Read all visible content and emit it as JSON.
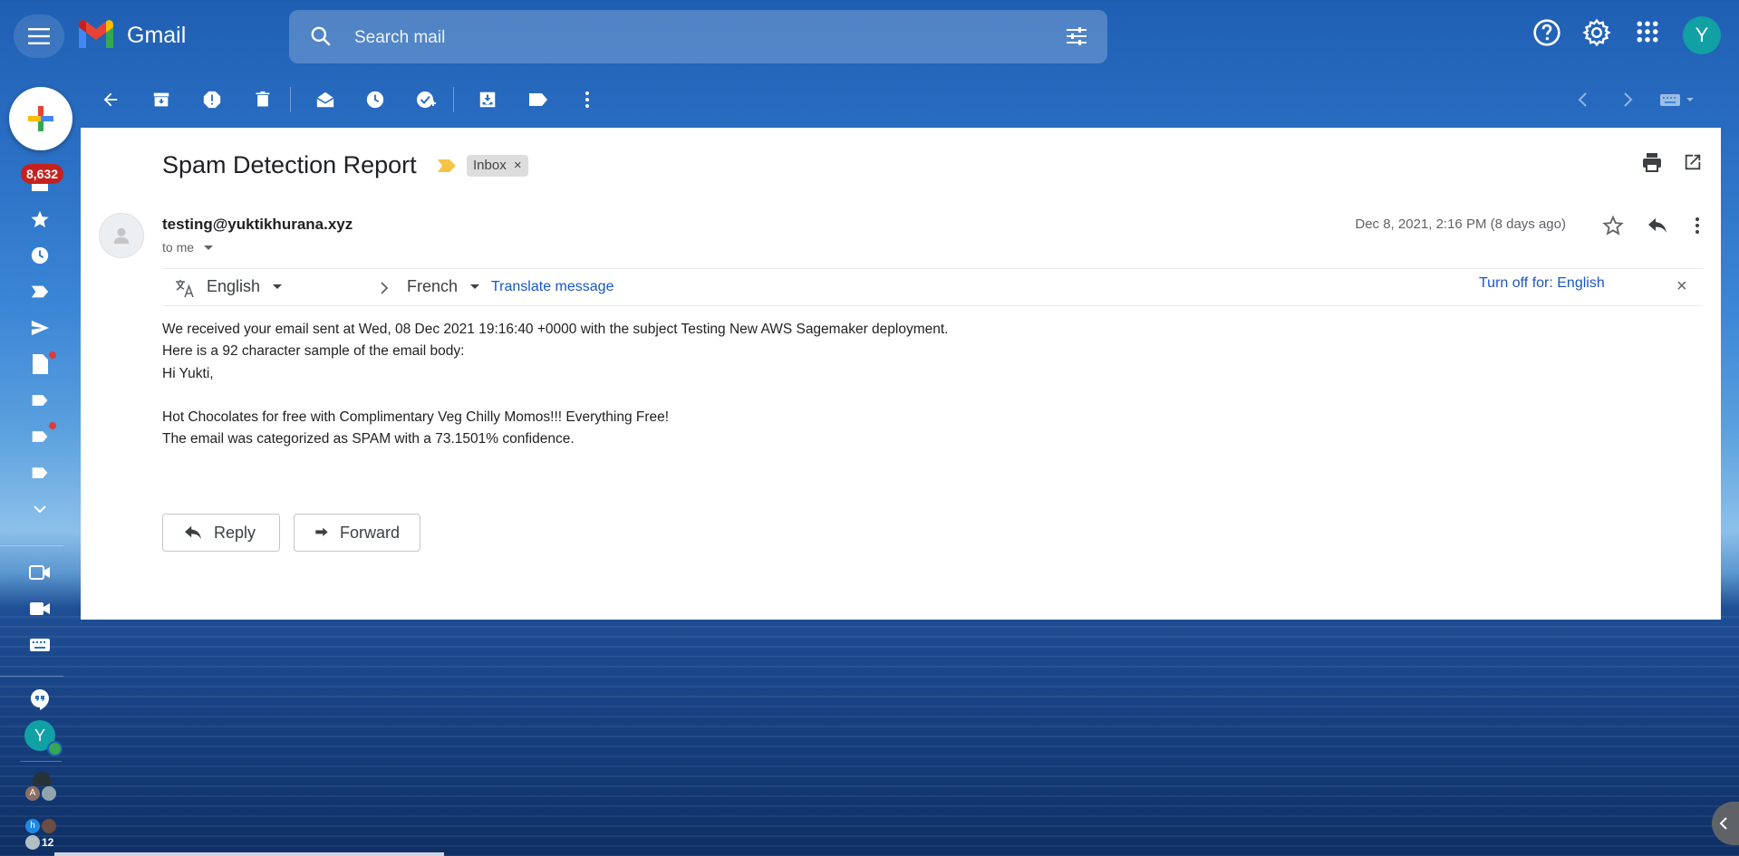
{
  "app": {
    "name": "Gmail",
    "account_initial": "Y",
    "unread_count": "8,632"
  },
  "search": {
    "placeholder": "Search mail"
  },
  "email": {
    "subject": "Spam Detection Report",
    "label": "Inbox",
    "label_remove": "×",
    "sender": "testing@yuktikhurana.xyz",
    "recipient_text": "to me",
    "date": "Dec 8, 2021, 2:16 PM (8 days ago)",
    "body_lines": [
      "We received your email sent at Wed, 08 Dec 2021 19:16:40 +0000 with the subject Testing New AWS Sagemaker deployment.",
      "Here is a 92 character sample of the email body:",
      "Hi Yukti,",
      "",
      "Hot Chocolates for free with Complimentary Veg Chilly Momos!!! Everything Free!",
      "The email was categorized as SPAM with a 73.1501% confidence."
    ]
  },
  "translate": {
    "from_lang": "English",
    "to_lang": "French",
    "translate_link": "Translate message",
    "turn_off": "Turn off for: English",
    "close": "×"
  },
  "actions": {
    "reply": "Reply",
    "forward": "Forward"
  },
  "rail": {
    "chat_avatar_initial": "Y",
    "group_small_letter_a": "A",
    "group_small_letter_h": "h",
    "group_count": "12"
  }
}
